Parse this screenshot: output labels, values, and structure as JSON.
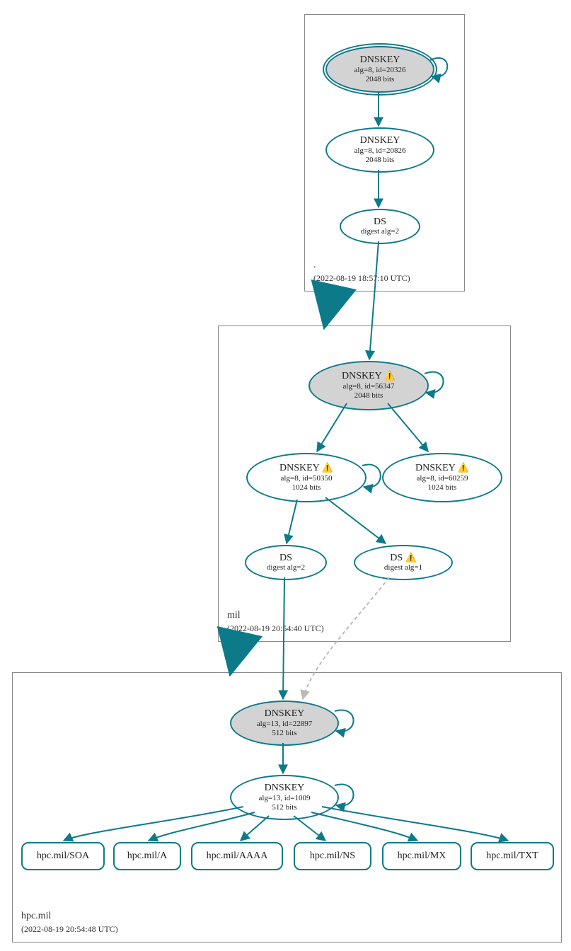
{
  "zones": {
    "root": {
      "label": ".",
      "timestamp": "(2022-08-19 18:57:10 UTC)",
      "dnskey1": {
        "title": "DNSKEY",
        "alg": "alg=8, id=20326",
        "bits": "2048 bits"
      },
      "dnskey2": {
        "title": "DNSKEY",
        "alg": "alg=8, id=20826",
        "bits": "2048 bits"
      },
      "ds": {
        "title": "DS",
        "digest": "digest alg=2"
      }
    },
    "mil": {
      "label": "mil",
      "timestamp": "(2022-08-19 20:54:40 UTC)",
      "dnskey1": {
        "title": "DNSKEY",
        "alg": "alg=8, id=56347",
        "bits": "2048 bits",
        "warn": "⚠️"
      },
      "dnskey2": {
        "title": "DNSKEY",
        "alg": "alg=8, id=50350",
        "bits": "1024 bits",
        "warn": "⚠️"
      },
      "dnskey3": {
        "title": "DNSKEY",
        "alg": "alg=8, id=60259",
        "bits": "1024 bits",
        "warn": "⚠️"
      },
      "ds1": {
        "title": "DS",
        "digest": "digest alg=2"
      },
      "ds2": {
        "title": "DS",
        "digest": "digest alg=1",
        "warn": "⚠️"
      }
    },
    "hpc": {
      "label": "hpc.mil",
      "timestamp": "(2022-08-19 20:54:48 UTC)",
      "dnskey1": {
        "title": "DNSKEY",
        "alg": "alg=13, id=22897",
        "bits": "512 bits"
      },
      "dnskey2": {
        "title": "DNSKEY",
        "alg": "alg=13, id=1009",
        "bits": "512 bits"
      },
      "records": {
        "soa": "hpc.mil/SOA",
        "a": "hpc.mil/A",
        "aaaa": "hpc.mil/AAAA",
        "ns": "hpc.mil/NS",
        "mx": "hpc.mil/MX",
        "txt": "hpc.mil/TXT"
      }
    }
  }
}
